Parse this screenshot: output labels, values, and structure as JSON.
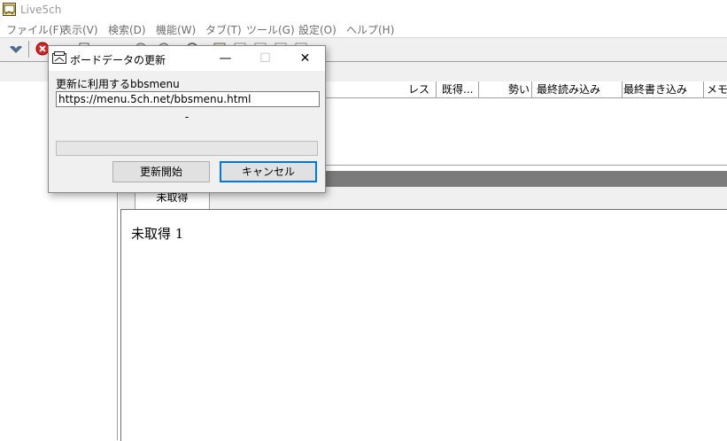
{
  "window": {
    "title": "Live5ch"
  },
  "menu": [
    {
      "label": "ファイル(F)"
    },
    {
      "label": "表示(V)"
    },
    {
      "label": "検索(D)"
    },
    {
      "label": "機能(W)"
    },
    {
      "label": "タブ(T)"
    },
    {
      "label": "ツール(G)"
    },
    {
      "label": "設定(O)"
    },
    {
      "label": "ヘルプ(H)"
    }
  ],
  "thread_list": {
    "columns": [
      "レス",
      "既得...",
      "勢い",
      "最終読み込み",
      "最終書き込み",
      "メモ"
    ]
  },
  "tabs": [
    {
      "label": "未取得"
    }
  ],
  "content": {
    "text": "未取得 1"
  },
  "dialog": {
    "title": "ボードデータの更新",
    "label": "更新に利用するbbsmenu",
    "url_value": "https://menu.5ch.net/bbsmenu.html",
    "status": "-",
    "progress": 0,
    "buttons": {
      "start": "更新開始",
      "cancel": "キャンセル"
    },
    "controls": {
      "minimize": "—",
      "maximize": "☐",
      "close": "✕"
    }
  },
  "colors": {
    "accent": "#0078d7",
    "progress": "#06b025",
    "splitter": "#7b7b7b"
  }
}
